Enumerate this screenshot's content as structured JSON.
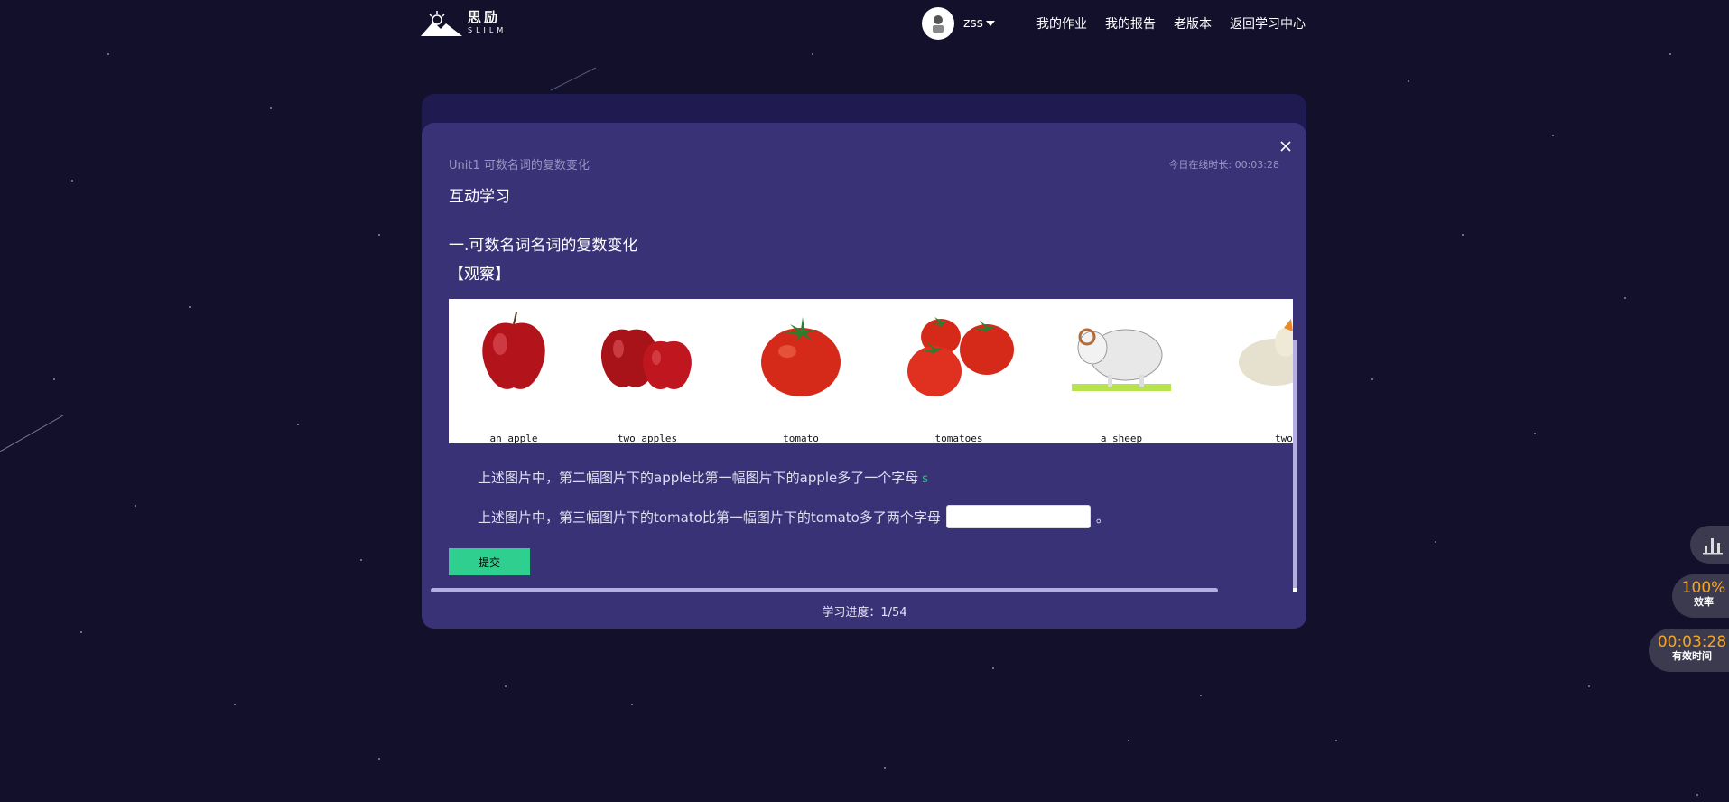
{
  "header": {
    "logo_cn": "思励",
    "logo_en": "SLILM",
    "username": "zss",
    "nav": [
      "我的作业",
      "我的报告",
      "老版本",
      "返回学习中心"
    ]
  },
  "lesson": {
    "unit_title": "Unit1 可数名词的复数变化",
    "online_time": "今日在线时长: 00:03:28",
    "section_title": "互动学习",
    "subheading_1": "一.可数名词名词的复数变化",
    "subheading_2": "【观察】",
    "image_captions": [
      "an apple",
      "two apples",
      "tomato",
      "tomatoes",
      "a sheep",
      "two"
    ],
    "q1_text": "上述图片中，第二幅图片下的apple比第一幅图片下的apple多了一个字母",
    "q1_answer": "s",
    "q2_text": "上述图片中，第三幅图片下的tomato比第一幅图片下的tomato多了两个字母",
    "q2_value": "",
    "q2_suffix": "。",
    "submit_label": "提交",
    "progress": "学习进度：1/54"
  },
  "widgets": {
    "efficiency_value": "100%",
    "efficiency_label": "效率",
    "effective_time_value": "00:03:28",
    "effective_time_label": "有效时间"
  },
  "colors": {
    "background": "#12102a",
    "card": "#3a3276",
    "submit": "#2ecf8f",
    "accent_orange": "#f5a623",
    "answer_green": "#2ec27e"
  }
}
